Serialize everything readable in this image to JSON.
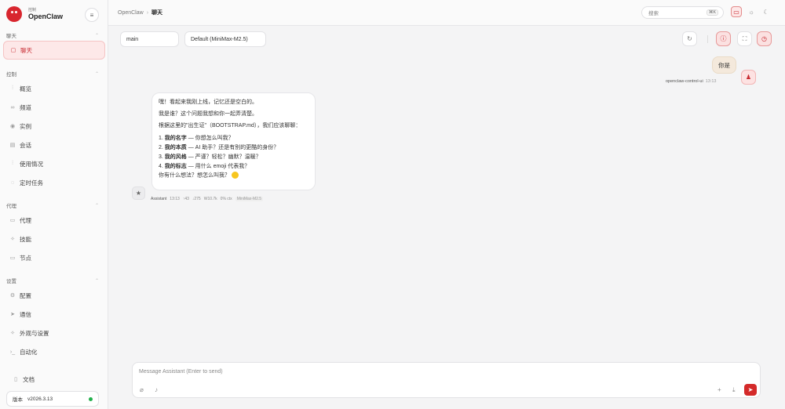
{
  "brand": {
    "subtitle": "控制",
    "name": "OpenClaw"
  },
  "sidebar": {
    "sections": [
      {
        "title": "聊天",
        "items": [
          {
            "label": "聊天",
            "icon": "chat-icon",
            "active": true
          }
        ]
      },
      {
        "title": "控制",
        "items": [
          {
            "label": "概览",
            "icon": "chart-icon"
          },
          {
            "label": "频道",
            "icon": "link-icon"
          },
          {
            "label": "实例",
            "icon": "radio-icon"
          },
          {
            "label": "会话",
            "icon": "document-icon"
          },
          {
            "label": "使用情况",
            "icon": "bar-chart-icon"
          },
          {
            "label": "定时任务",
            "icon": "clock-icon"
          }
        ]
      },
      {
        "title": "代理",
        "items": [
          {
            "label": "代理",
            "icon": "folder-icon"
          },
          {
            "label": "技能",
            "icon": "sparkle-icon"
          },
          {
            "label": "节点",
            "icon": "monitor-icon"
          }
        ]
      },
      {
        "title": "设置",
        "items": [
          {
            "label": "配置",
            "icon": "gear-icon"
          },
          {
            "label": "通信",
            "icon": "send-icon"
          },
          {
            "label": "外观与设置",
            "icon": "sparkle-icon"
          },
          {
            "label": "自动化",
            "icon": "terminal-icon"
          }
        ]
      }
    ],
    "docs_label": "文档",
    "version_label": "版本",
    "version_value": "v2026.3.13"
  },
  "topbar": {
    "breadcrumb_root": "OpenClaw",
    "breadcrumb_current": "聊天",
    "search_placeholder": "搜索",
    "search_shortcut": "⌘K"
  },
  "controls": {
    "session": "main",
    "model": "Default (MiniMax-M2.5)"
  },
  "messages": {
    "user": {
      "text": "你是",
      "sender": "openclaw-control-ui",
      "time": "13:13"
    },
    "assistant": {
      "line1": "嘿！看起来我刚上线，记忆还是空白的。",
      "line2": "我是谁？这个问题我想和你一起弄清楚。",
      "line3": "根据这里的\"出生证\"（BOOTSTRAP.md），我们应该聊聊：",
      "items": [
        {
          "num": "1.",
          "bold": "我的名字",
          "rest": " — 你想怎么叫我？"
        },
        {
          "num": "2.",
          "bold": "我的本质",
          "rest": " — AI 助手？还是有别的更酷的身份？"
        },
        {
          "num": "3.",
          "bold": "我的风格",
          "rest": " — 严谨？轻松？幽默？温暖？"
        },
        {
          "num": "4.",
          "bold": "我的标志",
          "rest": " — 用什么 emoji 代表我？"
        }
      ],
      "closing": "你有什么想法？想怎么叫我？",
      "meta": {
        "sender": "Assistant",
        "time": "13:13",
        "in_tokens": "↑43",
        "out_tokens": "↓275",
        "cache": "W10.7k",
        "ctx": "0% ctx",
        "model": "MiniMax-M2.5"
      }
    }
  },
  "composer": {
    "placeholder": "Message Assistant (Enter to send)"
  },
  "colors": {
    "accent": "#c7282f",
    "send": "#d42a2a",
    "online": "#22b04b"
  }
}
